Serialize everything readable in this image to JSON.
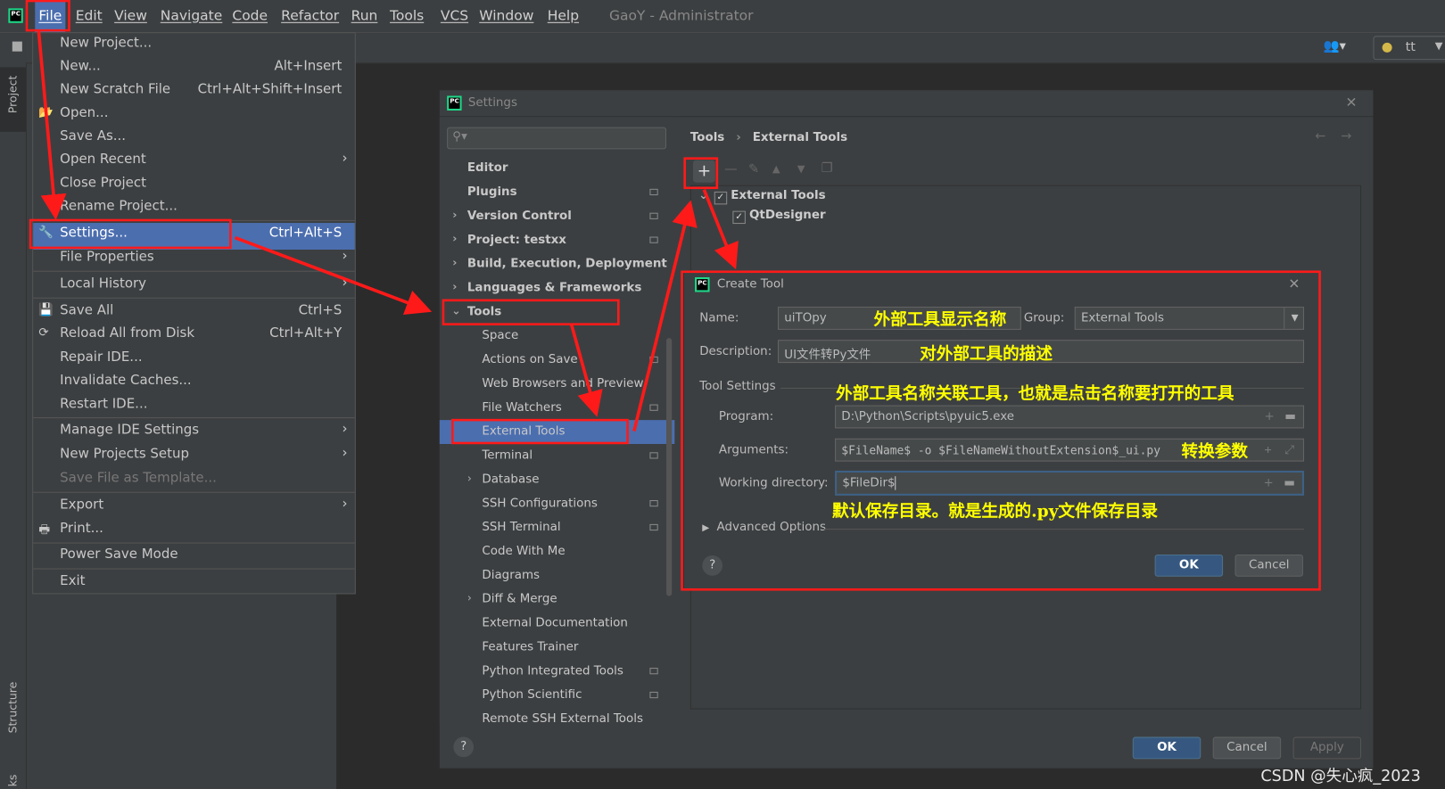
{
  "menubar": {
    "items": [
      "File",
      "Edit",
      "View",
      "Navigate",
      "Code",
      "Refactor",
      "Run",
      "Tools",
      "VCS",
      "Window",
      "Help"
    ],
    "window_title": "GaoY - Administrator"
  },
  "toolbar": {
    "run_config": "tt"
  },
  "tool_windows": {
    "project": "Project",
    "structure": "Structure",
    "bookmarks": "ks"
  },
  "file_menu": {
    "items": [
      {
        "label": "New Project...",
        "shortcut": ""
      },
      {
        "label": "New...",
        "shortcut": "Alt+Insert"
      },
      {
        "label": "New Scratch File",
        "shortcut": "Ctrl+Alt+Shift+Insert"
      },
      {
        "label": "Open...",
        "shortcut": "",
        "icon": "folder-open-icon"
      },
      {
        "label": "Save As...",
        "shortcut": ""
      },
      {
        "label": "Open Recent",
        "shortcut": "",
        "submenu": true
      },
      {
        "label": "Close Project",
        "shortcut": ""
      },
      {
        "label": "Rename Project...",
        "shortcut": ""
      },
      {
        "label": "Settings...",
        "shortcut": "Ctrl+Alt+S",
        "icon": "wrench-icon",
        "selected": true
      },
      {
        "label": "File Properties",
        "shortcut": "",
        "submenu": true
      },
      {
        "label": "Local History",
        "shortcut": "",
        "submenu": true
      },
      {
        "label": "Save All",
        "shortcut": "Ctrl+S",
        "icon": "save-icon"
      },
      {
        "label": "Reload All from Disk",
        "shortcut": "Ctrl+Alt+Y",
        "icon": "reload-icon"
      },
      {
        "label": "Repair IDE...",
        "shortcut": ""
      },
      {
        "label": "Invalidate Caches...",
        "shortcut": ""
      },
      {
        "label": "Restart IDE...",
        "shortcut": ""
      },
      {
        "label": "Manage IDE Settings",
        "shortcut": "",
        "submenu": true
      },
      {
        "label": "New Projects Setup",
        "shortcut": "",
        "submenu": true
      },
      {
        "label": "Save File as Template...",
        "shortcut": "",
        "disabled": true
      },
      {
        "label": "Export",
        "shortcut": "",
        "submenu": true
      },
      {
        "label": "Print...",
        "shortcut": "",
        "icon": "print-icon"
      },
      {
        "label": "Power Save Mode",
        "shortcut": ""
      },
      {
        "label": "Exit",
        "shortcut": ""
      }
    ]
  },
  "settings": {
    "title": "Settings",
    "search_placeholder": "",
    "sidebar": [
      {
        "label": "Editor",
        "level": 0,
        "bold": true
      },
      {
        "label": "Plugins",
        "level": 0,
        "bold": true,
        "project_icon": true
      },
      {
        "label": "Version Control",
        "level": 0,
        "bold": true,
        "expandable": true,
        "project_icon": true
      },
      {
        "label": "Project: testxx",
        "level": 0,
        "bold": true,
        "expandable": true,
        "project_icon": true
      },
      {
        "label": "Build, Execution, Deployment",
        "level": 0,
        "bold": true,
        "expandable": true
      },
      {
        "label": "Languages & Frameworks",
        "level": 0,
        "bold": true,
        "expandable": true
      },
      {
        "label": "Tools",
        "level": 0,
        "bold": true,
        "expanded": true
      },
      {
        "label": "Space",
        "level": 1
      },
      {
        "label": "Actions on Save",
        "level": 1,
        "project_icon": true
      },
      {
        "label": "Web Browsers and Preview",
        "level": 1
      },
      {
        "label": "File Watchers",
        "level": 1,
        "project_icon": true
      },
      {
        "label": "External Tools",
        "level": 1,
        "selected": true
      },
      {
        "label": "Terminal",
        "level": 1,
        "project_icon": true
      },
      {
        "label": "Database",
        "level": 1,
        "expandable": true
      },
      {
        "label": "SSH Configurations",
        "level": 1,
        "project_icon": true
      },
      {
        "label": "SSH Terminal",
        "level": 1,
        "project_icon": true
      },
      {
        "label": "Code With Me",
        "level": 1
      },
      {
        "label": "Diagrams",
        "level": 1
      },
      {
        "label": "Diff & Merge",
        "level": 1,
        "expandable": true
      },
      {
        "label": "External Documentation",
        "level": 1
      },
      {
        "label": "Features Trainer",
        "level": 1
      },
      {
        "label": "Python Integrated Tools",
        "level": 1,
        "project_icon": true
      },
      {
        "label": "Python Scientific",
        "level": 1,
        "project_icon": true
      },
      {
        "label": "Remote SSH External Tools",
        "level": 1
      }
    ],
    "breadcrumb": [
      "Tools",
      "External Tools"
    ],
    "tree": [
      {
        "label": "External Tools",
        "checked": true
      },
      {
        "label": "QtDesigner",
        "checked": true
      }
    ],
    "buttons": {
      "ok": "OK",
      "cancel": "Cancel",
      "apply": "Apply",
      "help": "?"
    }
  },
  "create_tool": {
    "title": "Create Tool",
    "name_label": "Name:",
    "name_value": "uiTOpy",
    "group_label": "Group:",
    "group_value": "External Tools",
    "description_label": "Description:",
    "description_value": "UI文件转Py文件",
    "tool_settings_label": "Tool Settings",
    "program_label": "Program:",
    "program_value": "D:\\Python\\Scripts\\pyuic5.exe",
    "arguments_label": "Arguments:",
    "arguments_value": "$FileName$ -o $FileNameWithoutExtension$_ui.py",
    "workdir_label": "Working directory:",
    "workdir_value": "$FileDir$",
    "advanced_label": "Advanced Options",
    "ok": "OK",
    "cancel": "Cancel",
    "help": "?"
  },
  "annotations": {
    "name_note": "外部工具显示名称",
    "description_note": "对外部工具的描述",
    "program_note": "外部工具名称关联工具，也就是点击名称要打开的工具",
    "arguments_note": "转换参数",
    "workdir_note": "默认保存目录。就是生成的.py文件保存目录",
    "color": "#ff0000",
    "note_color": "#ffff00"
  },
  "watermark": "CSDN @失心疯_2023",
  "colors": {
    "menu_bg": "#3c3f41",
    "selection": "#4b6eaf",
    "editor_bg": "#2b2b2b",
    "ok_button": "#365880"
  }
}
